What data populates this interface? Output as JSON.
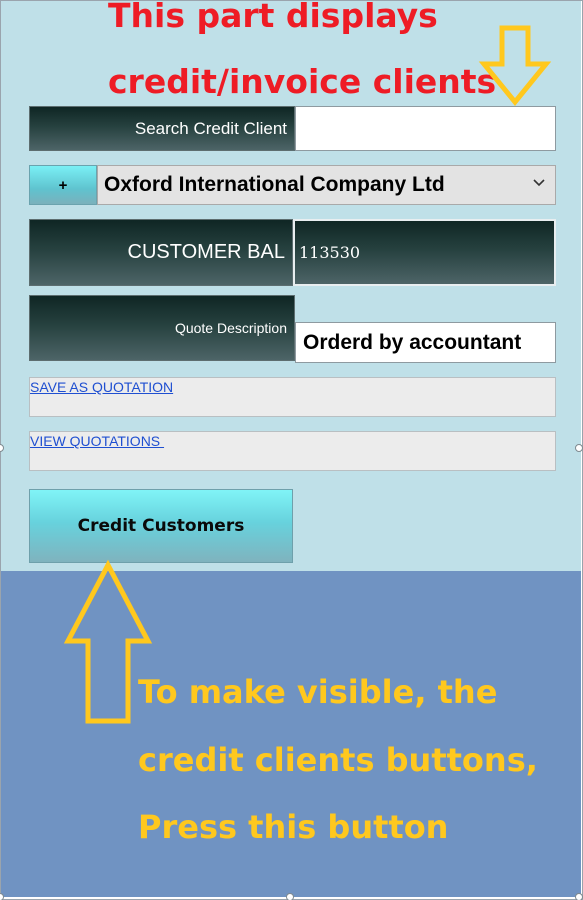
{
  "callouts": {
    "top_line1": "This part displays",
    "top_line2": "credit/invoice clients",
    "bottom_line1": "To make visible, the",
    "bottom_line2": "credit clients buttons,",
    "bottom_line3": "Press this button"
  },
  "search": {
    "label": "Search Credit Client",
    "value": "",
    "placeholder": ""
  },
  "client": {
    "add_label": "+",
    "selected": "Oxford International Company Ltd"
  },
  "balance": {
    "label": "CUSTOMER BAL",
    "value": "113530"
  },
  "quote": {
    "label": "Quote Description",
    "value": "Orderd by accountant"
  },
  "links": {
    "save_quotation": "SAVE AS QUOTATION",
    "view_quotations": "VIEW QUOTATIONS "
  },
  "buttons": {
    "credit_customers": "Credit Customers"
  },
  "icons": {
    "arrow_down": "arrow-down-icon",
    "arrow_up": "arrow-up-icon",
    "chevron": "chevron-down-icon"
  },
  "colors": {
    "top_panel": "#bfe0e8",
    "bottom_panel": "#7093c2",
    "callout_red": "#ee1c25",
    "callout_yellow": "#ffc81e",
    "link_blue": "#1f4fd1"
  }
}
